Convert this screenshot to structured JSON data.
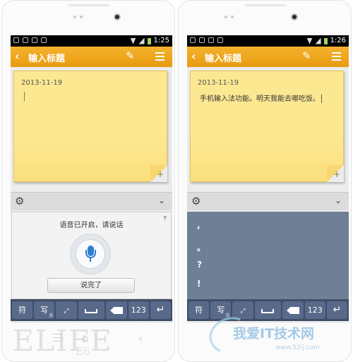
{
  "left_phone": {
    "status_time": "1:25",
    "title": "输入标题",
    "note_date": "2013-11-19",
    "voice": {
      "status": "语音已开启，请说话",
      "done_label": "说完了"
    },
    "keys": {
      "symbol": "符",
      "write": "写",
      "write_sub": "英",
      "num": "123"
    },
    "brand": "ELIFE",
    "brand_sub": "E6"
  },
  "right_phone": {
    "status_time": "1:26",
    "title": "输入标题",
    "note_date": "2013-11-19",
    "note_text": "手机输入法功能。明天我能去哪吃饭。",
    "punctuation": [
      ",",
      "。",
      "?",
      "!"
    ],
    "keys": {
      "symbol": "符",
      "write": "写",
      "write_sub": "英",
      "num": "123"
    }
  },
  "watermark": {
    "text": "我爱IT技术网",
    "url": "www.52ij.com"
  },
  "icons": {
    "back": "chevron-left-icon",
    "attach": "paperclip-icon",
    "menu": "menu-icon",
    "settings": "gear-icon",
    "collapse": "chevron-down-icon",
    "mic": "microphone-icon",
    "pin": "pin-icon"
  },
  "colors": {
    "title_bar": "#f0a51f",
    "note": "#fde892",
    "keyboard": "#3f4f67",
    "punct_panel": "#6f7f96",
    "mic": "#2f7fd0"
  }
}
